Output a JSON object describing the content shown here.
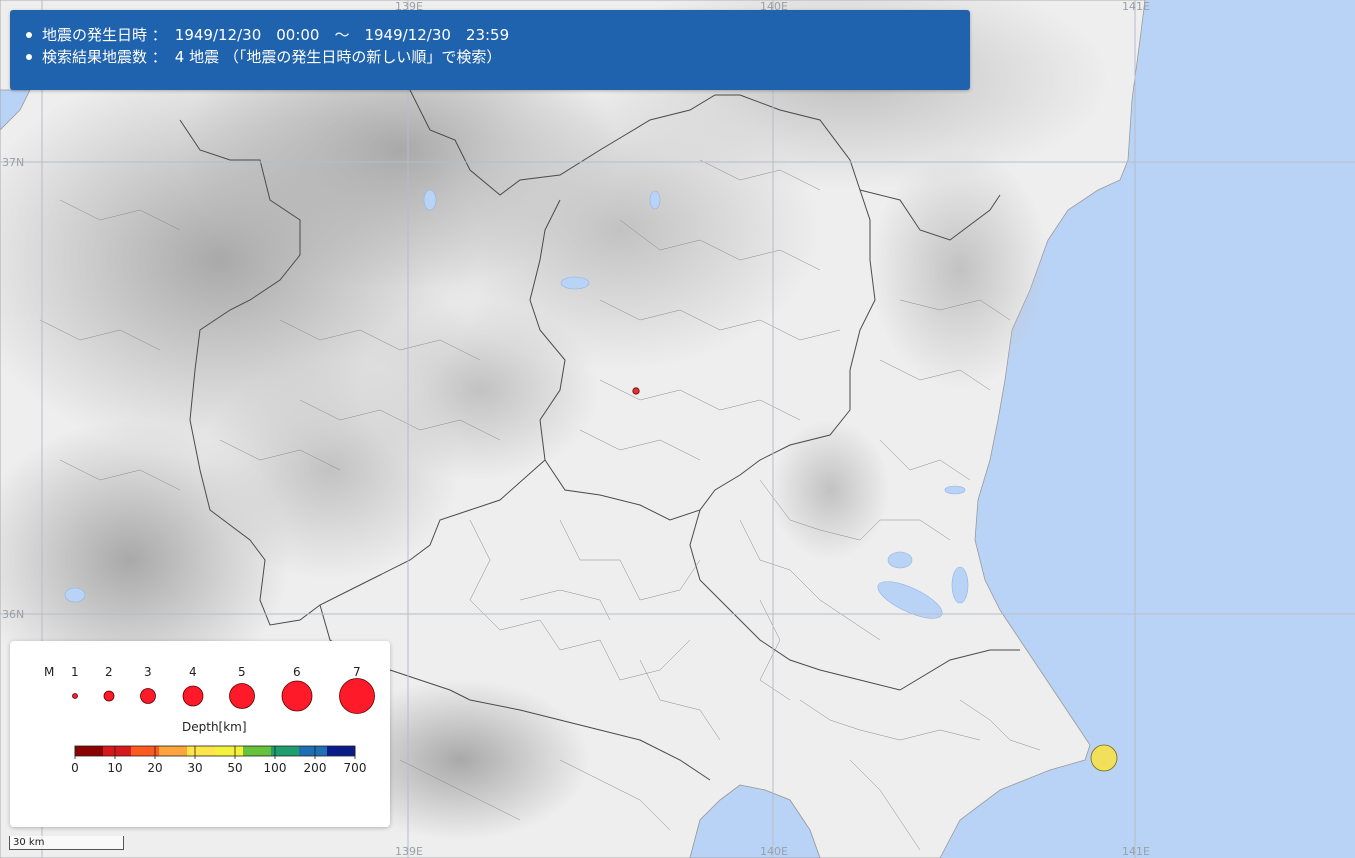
{
  "info": {
    "line1_label": "地震の発生日時 ：",
    "line1_value": "1949/12/30　00:00　～　1949/12/30　23:59",
    "line2_label": "検索結果地震数 ：",
    "line2_value": "4 地震 （「地震の発生日時の新しい順」で検索）"
  },
  "legend": {
    "magnitude_label": "M",
    "magnitudes": [
      "1",
      "2",
      "3",
      "4",
      "5",
      "6",
      "7"
    ],
    "depth_label": "Depth[km]",
    "depth_ticks": [
      "0",
      "10",
      "20",
      "30",
      "50",
      "100",
      "200",
      "700"
    ],
    "depth_colors": [
      "#8b0000",
      "#d7191c",
      "#ff5a1e",
      "#ffa43d",
      "#ffe548",
      "#f4f23b",
      "#66c23a",
      "#1e9e6e",
      "#1f6fb4",
      "#0a1b8a"
    ],
    "marker_color": "#ff1a2a"
  },
  "grid": {
    "lon_top": [
      "139E",
      "140E",
      "141E"
    ],
    "lon_bottom": [
      "139E",
      "140E",
      "141E"
    ],
    "lat_left": [
      "37N",
      "36N"
    ]
  },
  "scale": {
    "label": "30 km"
  },
  "earthquakes": [
    {
      "label": "shallow-small-event",
      "color": "#e23131"
    },
    {
      "label": "offshore-event",
      "color": "#f2df5a"
    }
  ],
  "colors": {
    "sea": "#b9d3f7",
    "land_low": "#f1f1f1",
    "land_high": "#b3b3b3",
    "info_bg": "#1f62ad"
  }
}
